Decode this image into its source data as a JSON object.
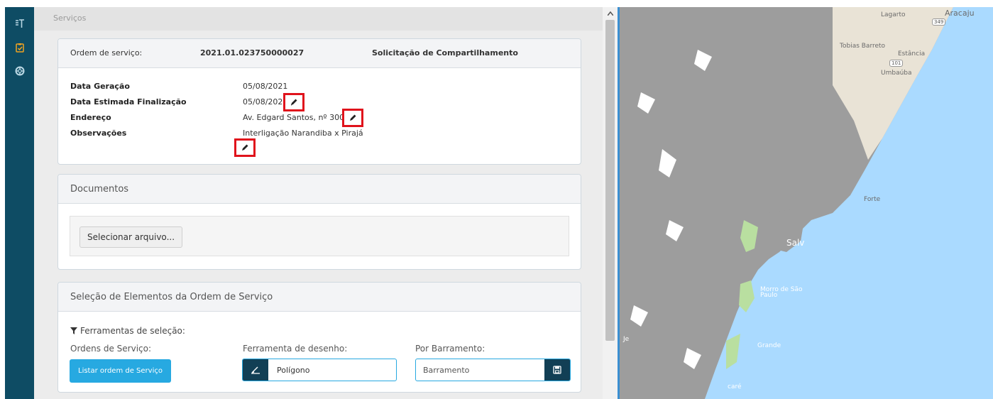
{
  "breadcrumb": "Serviços",
  "order": {
    "label": "Ordem de serviço:",
    "number": "2021.01.023750000027",
    "type": "Solicitação de Compartilhamento"
  },
  "details": {
    "date_generated_label": "Data Geração",
    "date_generated": "05/08/2021",
    "date_estimated_label": "Data Estimada Finalização",
    "date_estimated": "05/08/2021",
    "address_label": "Endereço",
    "address": "Av. Edgard Santos, nº 300",
    "notes_label": "Observações",
    "notes": "Interligação Narandiba x Pirajá"
  },
  "documents": {
    "title": "Documentos",
    "select_file": "Selecionar arquivo..."
  },
  "selection": {
    "title": "Seleção de Elementos da Ordem de Serviço",
    "tools_title": "Ferramentas de seleção:",
    "orders_label": "Ordens de Serviço:",
    "list_button": "Listar ordem de Serviço",
    "draw_label": "Ferramenta de desenho:",
    "draw_value": "Polígono",
    "bus_label": "Por Barramento:",
    "bus_placeholder": "Barramento"
  },
  "map": {
    "labels": [
      "Lagarto",
      "Aracaju",
      "Tobias Barreto",
      "Estância",
      "Umbaúba",
      "Forte",
      "Salv",
      "Morro de São Paulo",
      "Grande",
      "caré",
      "Je"
    ],
    "shields": [
      "349",
      "101"
    ]
  },
  "colors": {
    "sidebar": "#0e4c64",
    "accent": "#27a9e1",
    "highlight": "#e0131c",
    "dark_button": "#123f55",
    "water": "#aadaff",
    "land_overlay": "#9d9d9d"
  },
  "icons": {
    "sidebar": [
      "text-tool-icon",
      "clipboard-check-icon",
      "lifebuoy-icon"
    ],
    "edit": "pencil-icon",
    "filter": "filter-icon",
    "draw": "draw-pen-icon",
    "save": "save-icon"
  }
}
